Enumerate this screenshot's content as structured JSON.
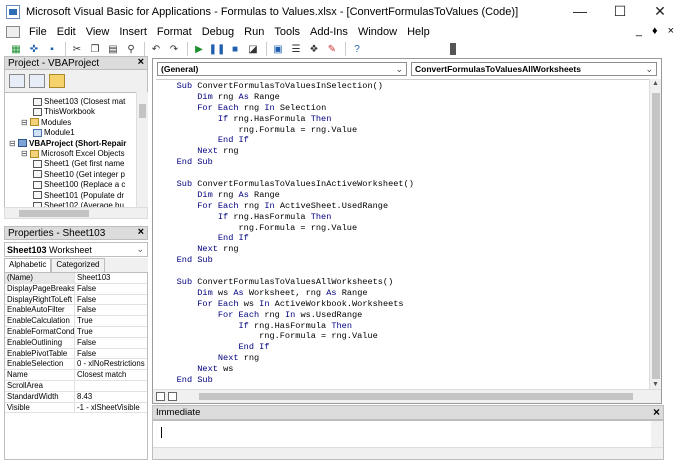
{
  "window": {
    "title": "Microsoft Visual Basic for Applications - Formulas to Values.xlsx - [ConvertFormulasToValues (Code)]",
    "controls": [
      "—",
      "☐",
      "✕"
    ]
  },
  "menu": {
    "items": [
      "File",
      "Edit",
      "View",
      "Insert",
      "Format",
      "Debug",
      "Run",
      "Tools",
      "Add-Ins",
      "Window",
      "Help"
    ],
    "mdi_controls": [
      "_",
      "♦",
      "×"
    ]
  },
  "project_pane": {
    "title": "Project - VBAProject",
    "nodes": [
      {
        "label": "Sheet103 (Closest mat",
        "kind": "sheet",
        "indent": 2
      },
      {
        "label": "ThisWorkbook",
        "kind": "sheet",
        "indent": 2
      },
      {
        "label": "Modules",
        "kind": "folder",
        "indent": 1,
        "expander": "⊟"
      },
      {
        "label": "Module1",
        "kind": "module",
        "indent": 2
      },
      {
        "label": "VBAProject (Short-Repair",
        "kind": "project",
        "indent": 0,
        "expander": "⊟",
        "bold": true
      },
      {
        "label": "Microsoft Excel Objects",
        "kind": "folder",
        "indent": 1,
        "expander": "⊟"
      },
      {
        "label": "Sheet1 (Get first name",
        "kind": "sheet",
        "indent": 2
      },
      {
        "label": "Sheet10 (Get integer p",
        "kind": "sheet",
        "indent": 2
      },
      {
        "label": "Sheet100 (Replace a c",
        "kind": "sheet",
        "indent": 2
      },
      {
        "label": "Sheet101 (Populate dr",
        "kind": "sheet",
        "indent": 2
      },
      {
        "label": "Sheet102 (Average bu",
        "kind": "sheet",
        "indent": 2
      }
    ]
  },
  "properties_pane": {
    "title": "Properties - Sheet103",
    "object_name": "Sheet103",
    "object_type": "Worksheet",
    "tabs": [
      "Alphabetic",
      "Categorized"
    ],
    "rows": [
      {
        "name": "(Name)",
        "value": "Sheet103"
      },
      {
        "name": "DisplayPageBreaks",
        "value": "False"
      },
      {
        "name": "DisplayRightToLeft",
        "value": "False"
      },
      {
        "name": "EnableAutoFilter",
        "value": "False"
      },
      {
        "name": "EnableCalculation",
        "value": "True"
      },
      {
        "name": "EnableFormatConditi",
        "value": "True"
      },
      {
        "name": "EnableOutlining",
        "value": "False"
      },
      {
        "name": "EnablePivotTable",
        "value": "False"
      },
      {
        "name": "EnableSelection",
        "value": "0 - xlNoRestrictions"
      },
      {
        "name": "Name",
        "value": "Closest match"
      },
      {
        "name": "ScrollArea",
        "value": ""
      },
      {
        "name": "StandardWidth",
        "value": "8.43"
      },
      {
        "name": "Visible",
        "value": "-1 - xlSheetVisible"
      }
    ]
  },
  "code_window": {
    "object_combo": "(General)",
    "proc_combo": "ConvertFormulasToValuesAllWorksheets",
    "lines": [
      "    Sub ConvertFormulasToValuesInSelection()",
      "        Dim rng As Range",
      "        For Each rng In Selection",
      "            If rng.HasFormula Then",
      "                rng.Formula = rng.Value",
      "            End If",
      "        Next rng",
      "    End Sub",
      "",
      "    Sub ConvertFormulasToValuesInActiveWorksheet()",
      "        Dim rng As Range",
      "        For Each rng In ActiveSheet.UsedRange",
      "            If rng.HasFormula Then",
      "                rng.Formula = rng.Value",
      "            End If",
      "        Next rng",
      "    End Sub",
      "",
      "    Sub ConvertFormulasToValuesAllWorksheets()",
      "        Dim ws As Worksheet, rng As Range",
      "        For Each ws In ActiveWorkbook.Worksheets",
      "            For Each rng In ws.UsedRange",
      "                If rng.HasFormula Then",
      "                    rng.Formula = rng.Value",
      "                End If",
      "            Next rng",
      "        Next ws",
      "    End Sub"
    ]
  },
  "immediate_pane": {
    "title": "Immediate"
  },
  "colors": {
    "keyword": "#00007f",
    "pane_header": "#dcdcdc"
  }
}
